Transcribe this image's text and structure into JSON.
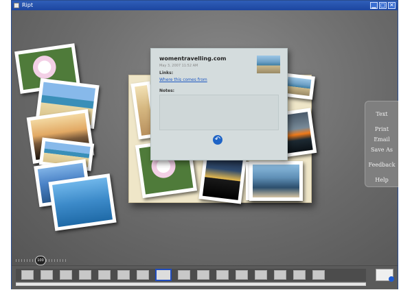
{
  "window": {
    "title": "Ript"
  },
  "card": {
    "site": "womentravelling.com",
    "date": "May 3, 2007 11:52 AM",
    "links_label": "Links:",
    "link_text": "Where this comes from",
    "notes_label": "Notes:"
  },
  "right_menu": [
    "Text",
    "Print",
    "Email",
    "Save As",
    "Feedback",
    "Help"
  ],
  "zoom": {
    "value": "100"
  },
  "filmstrip": {
    "thumbnail_count": 16,
    "selected_index": 7
  },
  "colors": {
    "titlebar": "#1d46a0",
    "selection": "#1f4bbd",
    "link": "#1a55c0",
    "back_button": "#1f64c6"
  }
}
